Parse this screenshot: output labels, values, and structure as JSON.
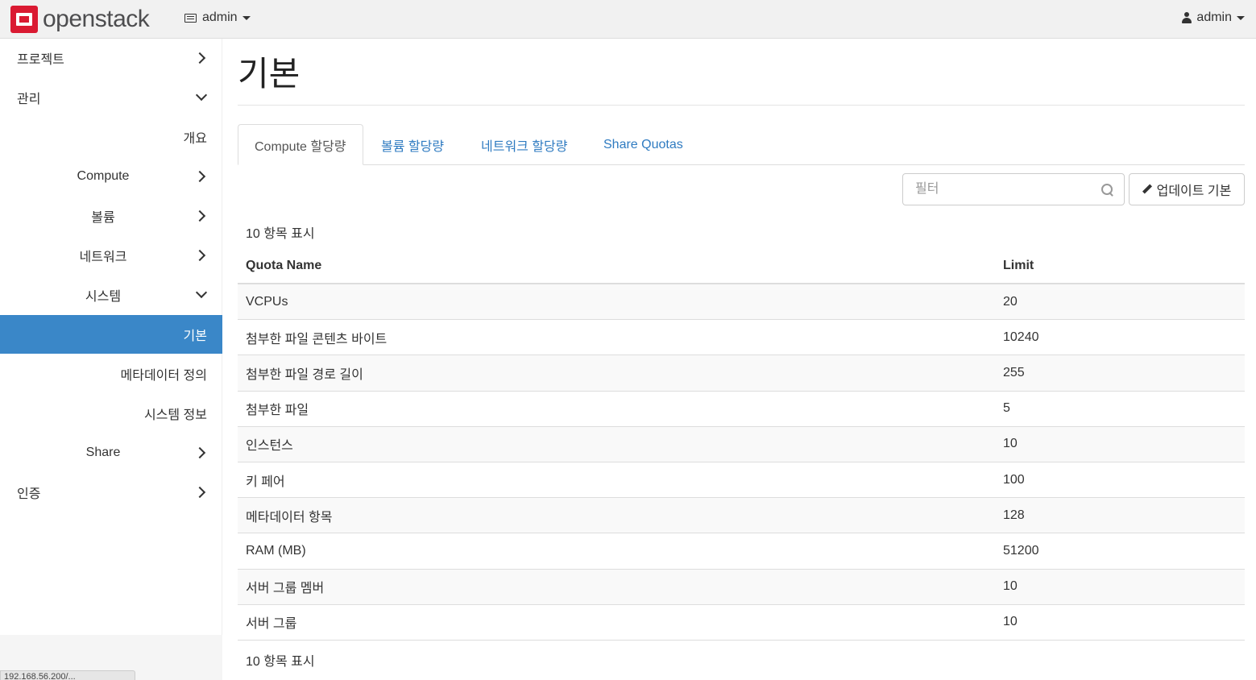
{
  "header": {
    "logo_text": "openstack",
    "project_menu": "admin",
    "user_menu": "admin"
  },
  "sidebar": {
    "items": [
      {
        "label": "프로젝트",
        "level": 0,
        "chevron": "right"
      },
      {
        "label": "관리",
        "level": 0,
        "chevron": "down"
      },
      {
        "label": "개요",
        "level": 2,
        "chevron": ""
      },
      {
        "label": "Compute",
        "level": 1,
        "chevron": "right"
      },
      {
        "label": "볼륨",
        "level": 1,
        "chevron": "right"
      },
      {
        "label": "네트워크",
        "level": 1,
        "chevron": "right"
      },
      {
        "label": "시스템",
        "level": 1,
        "chevron": "down"
      },
      {
        "label": "기본",
        "level": 2,
        "chevron": "",
        "active": true
      },
      {
        "label": "메타데이터 정의",
        "level": 2,
        "chevron": ""
      },
      {
        "label": "시스템 정보",
        "level": 2,
        "chevron": ""
      },
      {
        "label": "Share",
        "level": 1,
        "chevron": "right"
      },
      {
        "label": "인증",
        "level": 0,
        "chevron": "right"
      }
    ]
  },
  "page": {
    "title": "기본"
  },
  "tabs": [
    {
      "label": "Compute 할당량",
      "active": true
    },
    {
      "label": "볼륨 할당량",
      "active": false
    },
    {
      "label": "네트워크 할당량",
      "active": false
    },
    {
      "label": "Share Quotas",
      "active": false
    }
  ],
  "toolbar": {
    "filter_placeholder": "필터",
    "update_label": "업데이트 기본"
  },
  "table": {
    "count_top": "10 항목 표시",
    "count_bottom": "10 항목 표시",
    "headers": [
      "Quota Name",
      "Limit"
    ],
    "rows": [
      [
        "VCPUs",
        "20"
      ],
      [
        "첨부한 파일 콘텐츠 바이트",
        "10240"
      ],
      [
        "첨부한 파일 경로 길이",
        "255"
      ],
      [
        "첨부한 파일",
        "5"
      ],
      [
        "인스턴스",
        "10"
      ],
      [
        "키 페어",
        "100"
      ],
      [
        "메타데이터 항목",
        "128"
      ],
      [
        "RAM (MB)",
        "51200"
      ],
      [
        "서버 그룹 멤버",
        "10"
      ],
      [
        "서버 그룹",
        "10"
      ]
    ]
  },
  "statusbar": {
    "text": "192.168.56.200/..."
  },
  "colors": {
    "active_nav": "#3a87c8",
    "link": "#2f7bc1",
    "brand": "#da1a32"
  }
}
